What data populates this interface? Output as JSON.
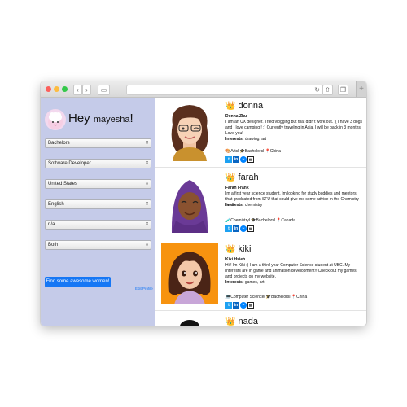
{
  "sidebar": {
    "greeting": "Hey",
    "username": "mayesha",
    "exclaim": "!",
    "selects": [
      {
        "value": "Bachelors"
      },
      {
        "value": "Software Developer"
      },
      {
        "value": "United States"
      },
      {
        "value": "English"
      },
      {
        "value": "n/a"
      },
      {
        "value": "Both"
      }
    ],
    "find_button": "Find some awesome women!",
    "edit_profile": "Edit Profile"
  },
  "profiles": [
    {
      "name": "donna",
      "full_name": "Donna Zhu",
      "bio": "I am an UX designer. Tried vlogging but that didn't work out. :( I have 3 dogs and I love camping!! :) Currently traveling in Asia, I will be back in 3 months. Love you!",
      "interests_label": "Interests:",
      "interests": "drawing, art",
      "tags": "🎨Artsl 🎓Bachelorsl 📍China",
      "bg_color": "#ffffff"
    },
    {
      "name": "farah",
      "full_name": "Farah Frank",
      "bio": "Im a first year science student. Im looking for study buddies and mentors that graduated from SFU that could give me some advice in the Chemistry field!",
      "interests_label": "Interests:",
      "interests": "chemistry",
      "tags": "🧪Chemistryl 🎓Bachelorsl 📍Canada",
      "bg_color": "#ffffff"
    },
    {
      "name": "kiki",
      "full_name": "Kiki Hsieh",
      "bio": "Hi!! Im Kiki :) I am a third year Computer Science student at UBC. My interests are in game and animation development!! Check out my games and projects on my website.",
      "interests_label": "Interests:",
      "interests": "games, art",
      "tags": "💻Computer Sciencel 🎓Bachelorsl 📍China",
      "bg_color": "#f7930f"
    },
    {
      "name": "nada"
    }
  ],
  "colors": {
    "sidebar_bg": "#c5cbe9",
    "accent": "#1677f5"
  }
}
